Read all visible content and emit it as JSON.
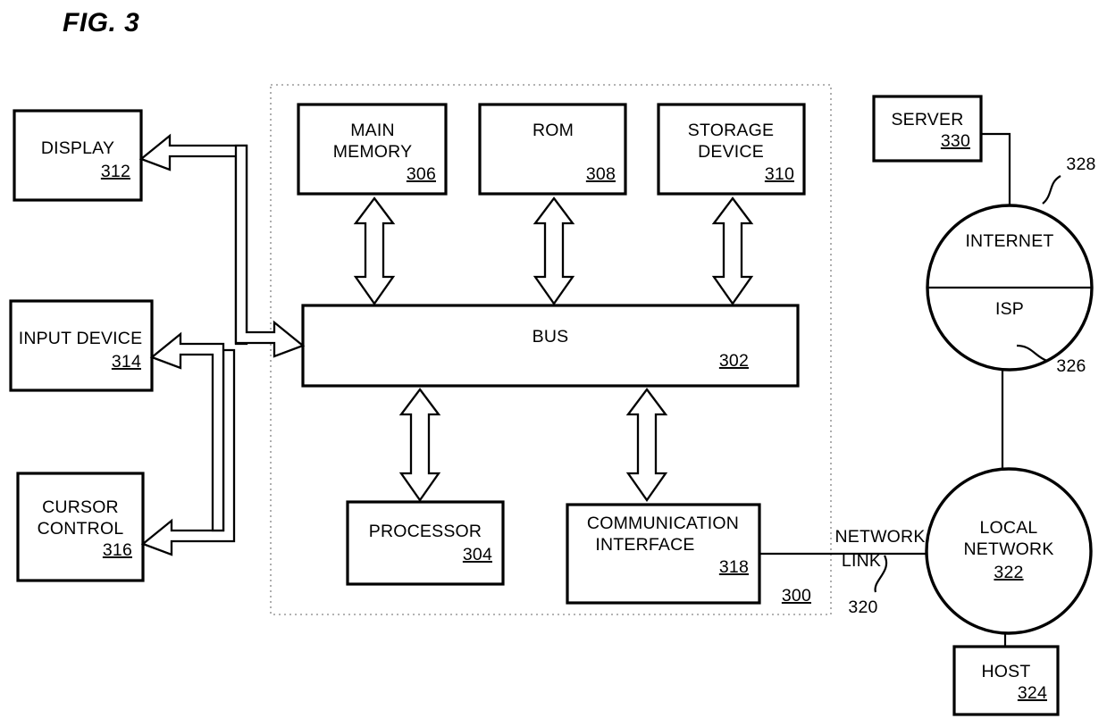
{
  "figure": {
    "title": "FIG. 3",
    "system_ref": "300"
  },
  "peripherals": [
    {
      "name": "display",
      "label": "DISPLAY",
      "ref": "312"
    },
    {
      "name": "input-device",
      "label": "INPUT DEVICE",
      "ref": "314"
    },
    {
      "name": "cursor-control",
      "label": "CURSOR",
      "label2": "CONTROL",
      "ref": "316"
    }
  ],
  "memory_blocks": [
    {
      "name": "main-memory",
      "label": "MAIN",
      "label2": "MEMORY",
      "ref": "306"
    },
    {
      "name": "rom",
      "label": "ROM",
      "label2": "",
      "ref": "308"
    },
    {
      "name": "storage-device",
      "label": "STORAGE",
      "label2": "DEVICE",
      "ref": "310"
    }
  ],
  "bus": {
    "label": "BUS",
    "ref": "302"
  },
  "processor": {
    "label": "PROCESSOR",
    "ref": "304"
  },
  "communication_interface": {
    "label": "COMMUNICATION",
    "label2": "INTERFACE",
    "ref": "318"
  },
  "network": {
    "link_label_line1": "NETWORK",
    "link_label_line2": "LINK",
    "link_ref": "320",
    "local_network_label1": "LOCAL",
    "local_network_label2": "NETWORK",
    "local_network_ref": "322",
    "host_label": "HOST",
    "host_ref": "324",
    "internet_label": "INTERNET",
    "isp_label": "ISP",
    "internet_ref": "328",
    "isp_ref": "326",
    "server_label": "SERVER",
    "server_ref": "330"
  },
  "colors": {
    "ink": "#000000",
    "paper": "#ffffff",
    "frame_dots": "#9a9a9a"
  }
}
